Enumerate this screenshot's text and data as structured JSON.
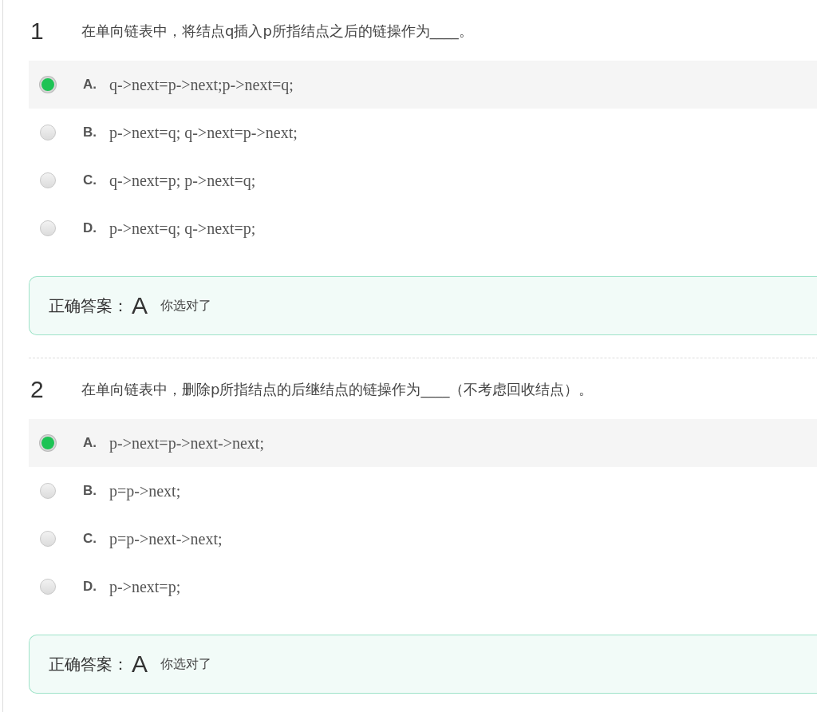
{
  "questions": [
    {
      "number": "1",
      "text": "在单向链表中，将结点q插入p所指结点之后的链操作为____。",
      "options": [
        {
          "letter": "A.",
          "text": "q->next=p->next;p->next=q;",
          "selected": true
        },
        {
          "letter": "B.",
          "text": "p->next=q; q->next=p->next;",
          "selected": false
        },
        {
          "letter": "C.",
          "text": "q->next=p; p->next=q;",
          "selected": false
        },
        {
          "letter": "D.",
          "text": "p->next=q; q->next=p;",
          "selected": false
        }
      ],
      "answer": {
        "label": "正确答案：",
        "value": "A",
        "verdict": "你选对了"
      }
    },
    {
      "number": "2",
      "text": "在单向链表中，删除p所指结点的后继结点的链操作为____（不考虑回收结点）。",
      "options": [
        {
          "letter": "A.",
          "text": "p->next=p->next->next;",
          "selected": true
        },
        {
          "letter": "B.",
          "text": "p=p->next;",
          "selected": false
        },
        {
          "letter": "C.",
          "text": "p=p->next->next;",
          "selected": false
        },
        {
          "letter": "D.",
          "text": "p->next=p;",
          "selected": false
        }
      ],
      "answer": {
        "label": "正确答案：",
        "value": "A",
        "verdict": "你选对了"
      }
    }
  ]
}
